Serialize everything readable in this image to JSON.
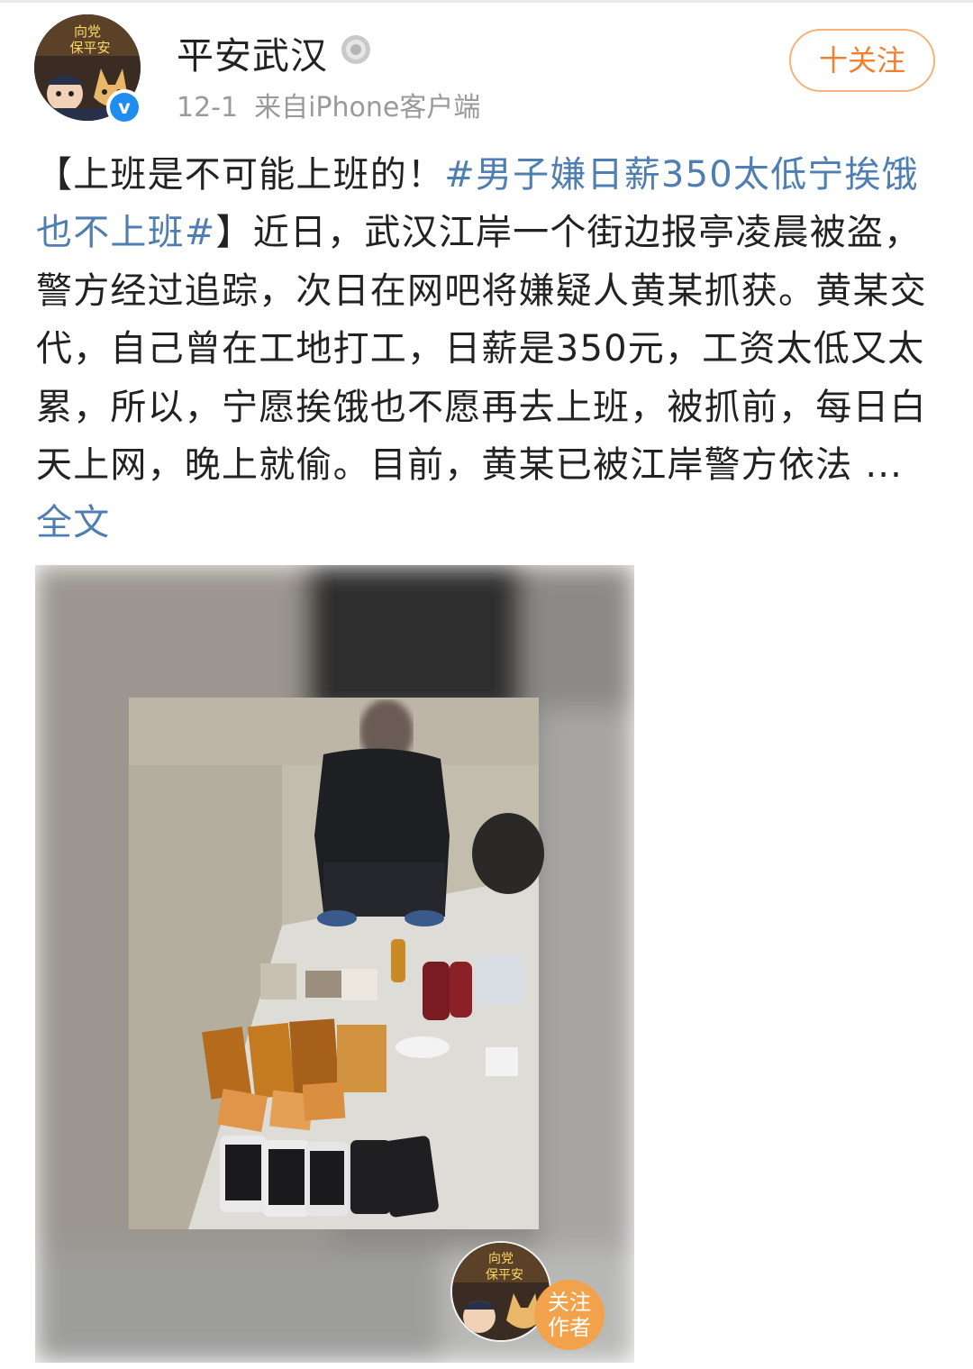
{
  "header": {
    "user_name": "平安武汉",
    "date": "12-1",
    "source_prefix": "来自",
    "source_app": "iPhone客户端",
    "follow_label": "十关注",
    "verified_icon": "v",
    "avatar_banner_line1": "向党",
    "avatar_banner_line2": "保平安"
  },
  "post": {
    "segments": [
      {
        "text": "【上班是不可能上班的！",
        "type": "text"
      },
      {
        "text": "#男子嫌日薪350太低宁挨饿也不上班#",
        "type": "hashtag"
      },
      {
        "text": "】近日，武汉江岸一个街边报亭凌晨被盗，警方经过追踪，次日在网吧将嫌疑人黄某抓获。黄某交代，自己曾在工地打工，日薪是350元，工资太低又太累，所以，宁愿挨饿也不愿再去上班，被抓前，每日白天上网，晚上就偷。目前，黄某已被江岸警方依法 ... ",
        "type": "text"
      },
      {
        "text": "全文",
        "type": "link"
      }
    ]
  },
  "image_overlay": {
    "banner_line1": "向党",
    "banner_line2": "保平安",
    "follow_author_line1": "关注",
    "follow_author_line2": "作者"
  },
  "colors": {
    "link": "#4f7fb2",
    "follow": "#f08030",
    "verified": "#1f8cf2"
  }
}
